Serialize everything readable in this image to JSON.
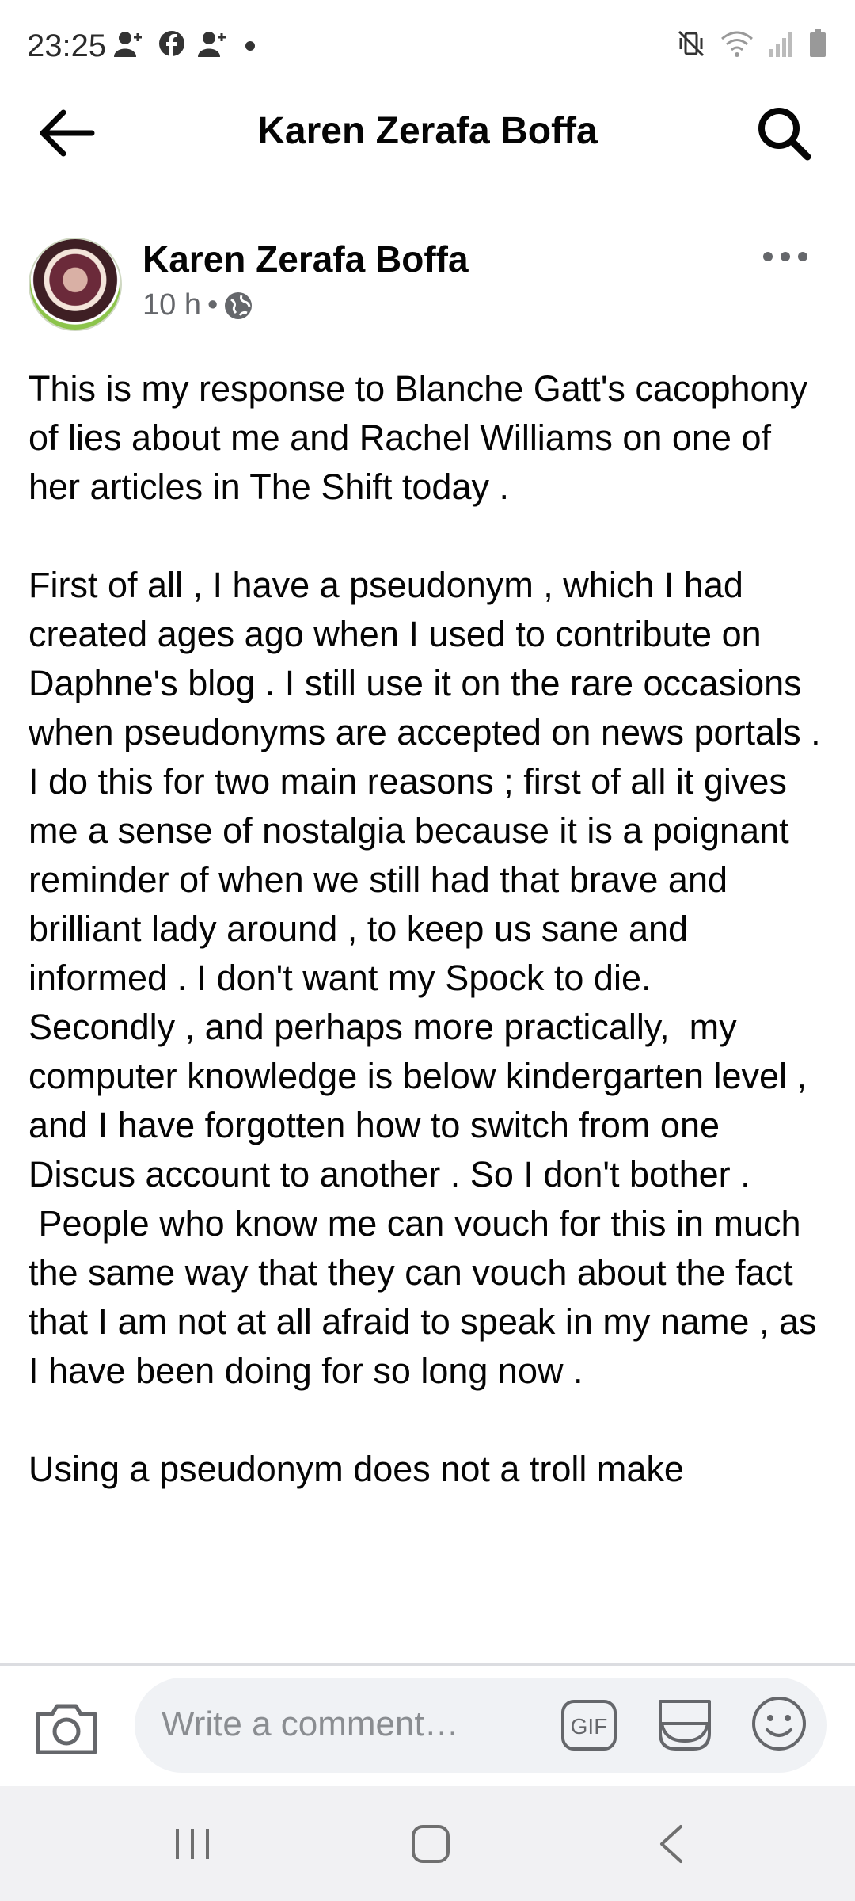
{
  "status_bar": {
    "time": "23:25",
    "left_icons": [
      "person-add-icon",
      "facebook-icon",
      "person-add-icon",
      "dot-icon"
    ],
    "right_icons": [
      "mute-vibrate-icon",
      "wifi-icon",
      "signal-icon",
      "battery-icon"
    ]
  },
  "header": {
    "title": "Karen Zerafa Boffa",
    "back_icon": "arrow-left-icon",
    "search_icon": "search-icon"
  },
  "post": {
    "author": "Karen Zerafa Boffa",
    "time": "10 h",
    "separator": "•",
    "audience_icon": "globe-icon",
    "more_icon": "more-horizontal-icon",
    "paragraphs": [
      "This is my response to Blanche Gatt's cacophony of lies about me and Rachel Williams on one of her articles in The Shift today .",
      "",
      "First of all , I have a pseudonym , which I had created ages ago when I used to contribute on Daphne's blog . I still use it on the rare occasions when pseudonyms are accepted on news portals . I do this for two main reasons ; first of all it gives me a sense of nostalgia because it is a poignant reminder of when we still had that brave and brilliant lady around , to keep us sane and informed . I don't want my Spock to die.",
      "Secondly , and perhaps more practically,  my computer knowledge is below kindergarten level , and I have forgotten how to switch from one Discus account to another . So I don't bother .",
      " People who know me can vouch for this in much the same way that they can vouch about the fact that I am not at all afraid to speak in my name , as I have been doing for so long now .",
      "",
      "Using a pseudonym does not a troll make"
    ]
  },
  "comment_bar": {
    "placeholder": "Write a comment…",
    "gif_label": "GIF",
    "camera_icon": "camera-icon",
    "sticker_icon": "sticker-icon",
    "emoji_icon": "emoji-icon"
  },
  "nav_bar": {
    "recent_icon": "recent-apps-icon",
    "home_icon": "home-icon",
    "back_icon": "nav-back-icon"
  },
  "colors": {
    "text": "#050505",
    "secondary_text": "#65676b",
    "input_background": "#f0f2f5",
    "nav_background": "#f1f1f3",
    "avatar_border": "#8cc44a"
  }
}
